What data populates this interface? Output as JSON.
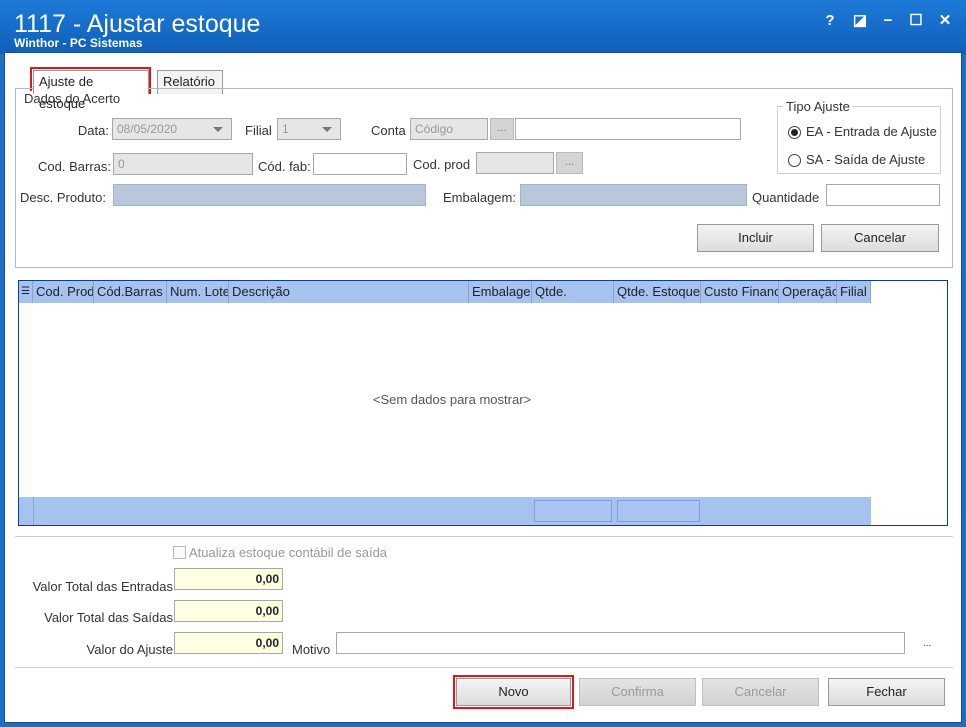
{
  "window": {
    "title": "1117 - Ajustar estoque",
    "subtitle": "Winthor - PC Sistemas",
    "help": "?",
    "restore": "◪",
    "minimize": "−",
    "maximize": "☐",
    "close": "✕"
  },
  "tabs": [
    {
      "label": "Ajuste de estoque",
      "active": true
    },
    {
      "label": "Relatório",
      "active": false
    }
  ],
  "acerto": {
    "legend": "Dados do Acerto",
    "data_label": "Data:",
    "data_value": "08/05/2020",
    "filial_label": "Filial",
    "filial_value": "1",
    "conta_label": "Conta",
    "conta_placeholder": "Código",
    "ellipsis": "...",
    "cod_barras_label": "Cod. Barras:",
    "cod_barras_value": "0",
    "cod_fab_label": "Cód. fab:",
    "cod_prod_label": "Cod. prod",
    "desc_produto_label": "Desc. Produto:",
    "embalagem_label": "Embalagem:",
    "quantidade_label": "Quantidade",
    "incluir": "Incluir",
    "cancelar": "Cancelar"
  },
  "tipo_ajuste": {
    "legend": "Tipo Ajuste",
    "options": [
      {
        "label": "EA - Entrada de Ajuste",
        "selected": true
      },
      {
        "label": "SA - Saída de Ajuste",
        "selected": false
      }
    ]
  },
  "grid": {
    "columns": [
      "Cod. Prod",
      "Cód.Barras",
      "Num. Lote",
      "Descrição",
      "Embalagem",
      "Qtde.",
      "Qtde. Estoque",
      "Custo Financ",
      "Operação",
      "Filial"
    ],
    "empty_text": "<Sem dados para mostrar>"
  },
  "totals": {
    "atualiza_label": "Atualiza estoque contábil de saída",
    "atualiza_checked": false,
    "entradas_label": "Valor Total das Entradas",
    "entradas_value": "0,00",
    "saidas_label": "Valor Total das Saídas",
    "saidas_value": "0,00",
    "ajuste_label": "Valor do Ajuste",
    "ajuste_value": "0,00",
    "motivo_label": "Motivo",
    "ellipsis": "..."
  },
  "footer": {
    "novo": "Novo",
    "confirma": "Confirma",
    "cancelar": "Cancelar",
    "fechar": "Fechar"
  },
  "colors": {
    "titlebar": "#1e7ad8",
    "grid_header": "#a6c2ef",
    "highlight": "#e2141d"
  }
}
